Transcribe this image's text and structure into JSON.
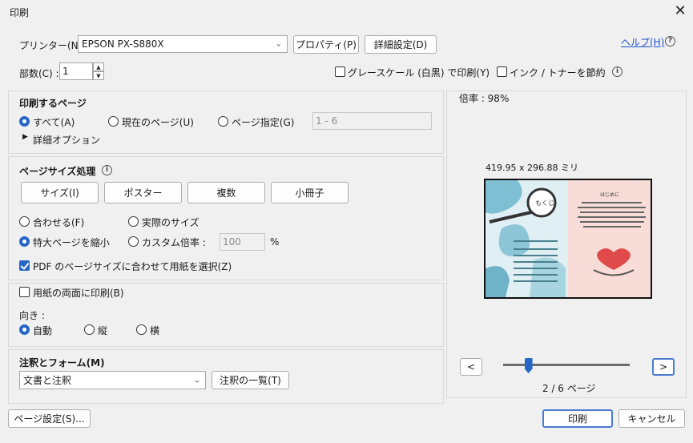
{
  "window": {
    "title": "印刷",
    "close_glyph": "✕"
  },
  "printer": {
    "label": "プリンター(N) :",
    "value": "EPSON PX-S880X",
    "properties_button": "プロパティ(P)",
    "advanced_button": "詳細設定(D)",
    "help_link": "ヘルプ(H)"
  },
  "copies": {
    "label": "部数(C) :",
    "value": "1"
  },
  "options": {
    "grayscale_label": "グレースケール (白黒) で印刷(Y)",
    "grayscale_checked": false,
    "save_ink_label": "インク / トナーを節約",
    "save_ink_checked": false
  },
  "pages_to_print": {
    "heading": "印刷するページ",
    "all_label": "すべて(A)",
    "current_label": "現在のページ(U)",
    "range_label": "ページ指定(G)",
    "range_value": "1 - 6",
    "selected": "all",
    "more_options": "詳細オプション"
  },
  "page_sizing": {
    "heading": "ページサイズ処理",
    "tabs": [
      "サイズ(I)",
      "ポスター",
      "複数",
      "小冊子"
    ],
    "fit_label": "合わせる(F)",
    "actual_label": "実際のサイズ",
    "shrink_label": "特大ページを縮小",
    "custom_label": "カスタム倍率 :",
    "custom_value": "100",
    "percent": "%",
    "selected": "shrink",
    "pdf_paper_label": "PDF のページサイズに合わせて用紙を選択(Z)",
    "pdf_paper_checked": true
  },
  "duplex": {
    "label": "用紙の両面に印刷(B)",
    "checked": false
  },
  "orientation": {
    "label": "向き :",
    "auto_label": "自動",
    "portrait_label": "縦",
    "landscape_label": "横",
    "selected": "auto"
  },
  "comments": {
    "heading": "注釈とフォーム(M)",
    "value": "文書と注釈",
    "summary_button": "注釈の一覧(T)"
  },
  "preview": {
    "scale": "倍率 : 98%",
    "dimensions": "419.95 x 296.88 ミリ",
    "page_indicator": "2 / 6 ページ",
    "slider_fraction": 0.2,
    "prev_glyph": "<",
    "next_glyph": ">",
    "left_page_title": "もくじ",
    "right_page_title": "はじめに"
  },
  "footer": {
    "page_setup_button": "ページ設定(S)...",
    "print_button": "印刷",
    "cancel_button": "キャンセル"
  },
  "colors": {
    "accent": "#2566c7",
    "link": "#1a4fd0",
    "preview_left_bg": "#dfeff4",
    "preview_right_bg": "#f7dcd8"
  }
}
